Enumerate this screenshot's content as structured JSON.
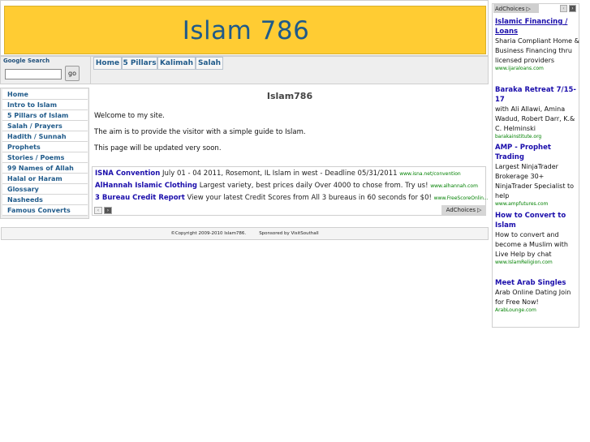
{
  "header": {
    "title": "Islam 786",
    "banner_color": "#ffcc33"
  },
  "search": {
    "label": "Google Search",
    "button": "go",
    "placeholder": ""
  },
  "topnav": {
    "items": [
      "Home",
      "5 Pillars",
      "Kalimah",
      "Salah"
    ]
  },
  "sidebar": {
    "items": [
      "Home",
      "Intro to Islam",
      "5 Pillars of Islam",
      "Salah / Prayers",
      "Hadith / Sunnah",
      "Prophets",
      "Stories / Poems",
      "99 Names of Allah",
      "Halal or Haram",
      "Glossary",
      "Nasheeds",
      "Famous Converts"
    ]
  },
  "main": {
    "title": "Islam786",
    "paragraphs": [
      "Welcome to my site.",
      "The aim is to provide the visitor with a simple guide to Islam.",
      "This page will be updated very soon."
    ]
  },
  "bottom_ads": {
    "items": [
      {
        "title": "ISNA Convention",
        "desc": "July 01 - 04 2011, Rosemont, IL Islam in west - Deadline 05/31/2011",
        "url": "www.isna.net/convention"
      },
      {
        "title": "AlHannah Islamic Clothing",
        "desc": "Largest variety, best prices daily Over 4000 to chose from. Try us!",
        "url": "www.alhannah.com"
      },
      {
        "title": "3 Bureau Credit Report",
        "desc": "View your latest Credit Scores from All 3 bureaus in 60 seconds for $0!",
        "url": "www.FreeScoreOnlin..."
      }
    ],
    "adchoices": "AdChoices",
    "prev": "‹",
    "next": "›"
  },
  "footer": {
    "copyright": "©Copyright 2009-2010 Islam786.",
    "sponsor": "Sponsored by VisitSouthall"
  },
  "right_ads": {
    "adchoices": "AdChoices",
    "prev": "‹",
    "next": "›",
    "items": [
      {
        "title": "Islamic Financing / Loans",
        "desc": "Sharia Compliant Home & Business Financing thru licensed providers",
        "url": "www.ijaraloans.com"
      },
      {
        "title": "Baraka Retreat 7/15-17",
        "desc": "with Ali Allawi, Amina Wadud, Robert Darr, K.& C. Helminski",
        "url": "barakainstitute.org"
      },
      {
        "title": "AMP - Prophet Trading",
        "desc": "Largest NinjaTrader Brokerage 30+ NinjaTrader Specialist to help",
        "url": "www.ampfutures.com"
      },
      {
        "title": "How to Convert to Islam",
        "desc": "How to convert and become a Muslim with Live Help by chat",
        "url": "www.IslamReligion.com"
      },
      {
        "title": "Meet Arab Singles",
        "desc": "Arab Online Dating Join for Free Now!",
        "url": "ArabLounge.com"
      }
    ]
  }
}
